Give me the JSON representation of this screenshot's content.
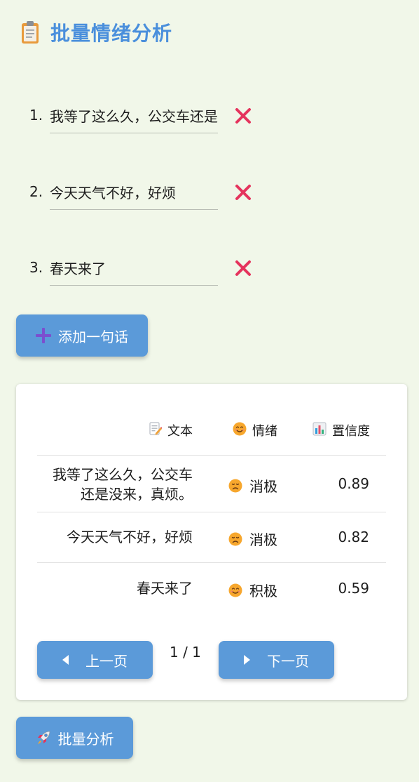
{
  "title": "批量情绪分析",
  "icons": {
    "title": "clipboard-icon",
    "delete": "close-x-icon",
    "add": "plus-icon",
    "text_col": "memo-icon",
    "sentiment_col": "smiling-face-icon",
    "confidence_col": "bar-chart-icon",
    "negative": "disappointed-face-icon",
    "positive": "smiling-face-icon",
    "prev": "triangle-left-icon",
    "next": "triangle-right-icon",
    "analyze": "rocket-icon"
  },
  "inputs": [
    {
      "num": "1.",
      "value": "我等了这么久，公交车还是没来，真烦。"
    },
    {
      "num": "2.",
      "value": "今天天气不好，好烦"
    },
    {
      "num": "3.",
      "value": "春天来了"
    }
  ],
  "add_button": "添加一句话",
  "table": {
    "headers": {
      "text": "文本",
      "sentiment": "情绪",
      "confidence": "置信度"
    },
    "rows": [
      {
        "text": "我等了这么久，公交车还是没来，真烦。",
        "sentiment": "消极",
        "confidence": "0.89",
        "polarity": "negative"
      },
      {
        "text": "今天天气不好，好烦",
        "sentiment": "消极",
        "confidence": "0.82",
        "polarity": "negative"
      },
      {
        "text": "春天来了",
        "sentiment": "积极",
        "confidence": "0.59",
        "polarity": "positive"
      }
    ]
  },
  "pager": {
    "prev": "上一页",
    "next": "下一页",
    "indicator": "1 / 1"
  },
  "analyze_button": "批量分析",
  "colors": {
    "accent": "#5b9ad9",
    "title": "#4a8fdc",
    "delete": "#e5345d",
    "background": "#f1f7e9"
  }
}
